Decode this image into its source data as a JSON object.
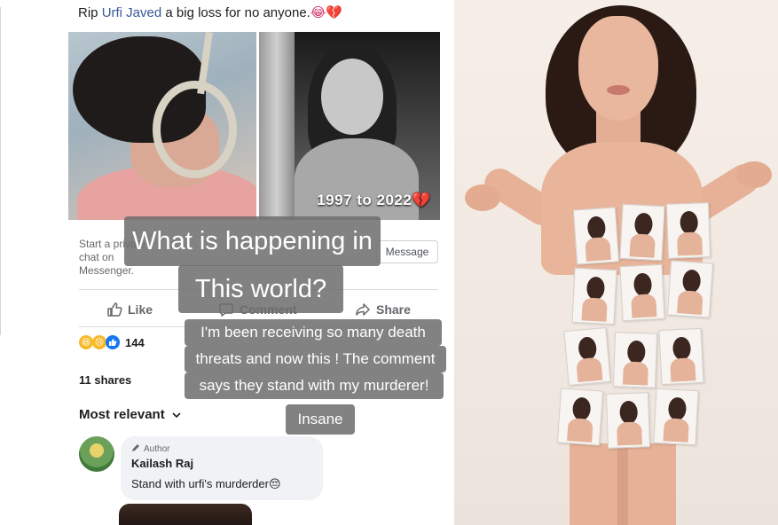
{
  "post": {
    "prefix": "Rip ",
    "mention": "Urfi Javed",
    "suffix": " a big loss for no anyone.",
    "emojis": "😂💔",
    "photo_caption": "1997 to 2022",
    "photo_emoji": "💔"
  },
  "messenger": {
    "start_text": "Start a private chat on Messenger.",
    "button_label": "Message"
  },
  "actions": {
    "like": "Like",
    "comment": "Comment",
    "share": "Share"
  },
  "stats": {
    "reaction_count": "144",
    "shares": "11 shares"
  },
  "sort": {
    "label": "Most relevant"
  },
  "comment": {
    "author_tag": "Author",
    "name": "Kailash Raj",
    "text": "Stand with urfi's murderder",
    "emoji": "😔"
  },
  "overlays": {
    "question_line1": "What is happening in",
    "question_line2": "This world?",
    "story_line1": "I'm been receiving so many death",
    "story_line2": "threats and now this ! The comment",
    "story_line3": "says they stand with my murderer!",
    "story_line4": "Insane"
  },
  "colors": {
    "mention": "#385898",
    "overlay_bg": "#6e6e6e",
    "like_blue": "#1877f2"
  },
  "icons": {
    "like": "thumbs-up-icon",
    "comment": "speech-bubble-icon",
    "share": "share-arrow-icon",
    "author": "pencil-icon",
    "sort": "chevron-down-icon"
  }
}
